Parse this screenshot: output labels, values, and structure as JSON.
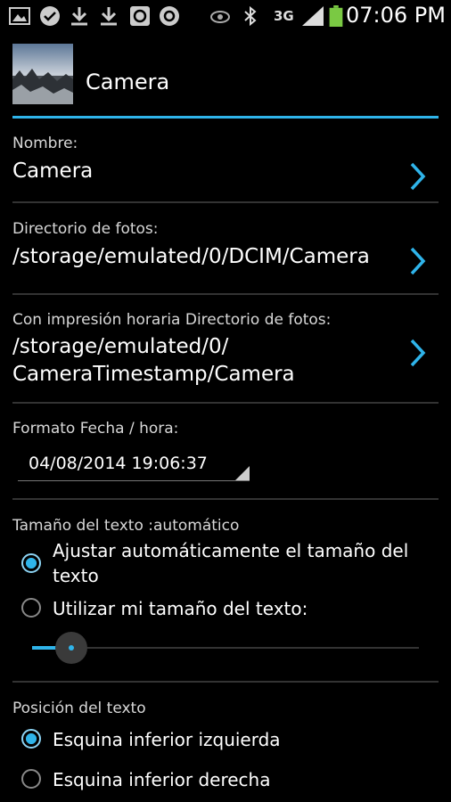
{
  "status_bar": {
    "time": "07:06 PM",
    "network": "3G",
    "icons": [
      "gallery-icon",
      "check-circle-icon",
      "download-icon",
      "download-icon",
      "app-icon",
      "sync-icon",
      "eye-icon",
      "bluetooth-icon",
      "signal-icon",
      "battery-icon"
    ]
  },
  "header": {
    "title": "Camera"
  },
  "prefs": {
    "nombre": {
      "label": "Nombre:",
      "value": "Camera"
    },
    "directorio": {
      "label": "Directorio de fotos:",
      "value": "/storage/emulated/0/DCIM/Camera"
    },
    "timestamp_dir": {
      "label": "Con impresión horaria Directorio de fotos:",
      "value_line1": "/storage/emulated/0/",
      "value_line2": "CameraTimestamp/Camera"
    },
    "formato": {
      "label": "Formato Fecha / hora:",
      "value": "04/08/2014 19:06:37"
    }
  },
  "text_size": {
    "label": "Tamaño del texto :automático",
    "option_auto_line1": "Ajustar automáticamente el tamaño del",
    "option_auto_line2": "texto",
    "option_custom": "Utilizar mi tamaño del texto:",
    "selected": "auto",
    "slider_level": 0.1
  },
  "text_position": {
    "label": "Posición del texto",
    "option_left": "Esquina inferior izquierda",
    "option_right": "Esquina inferior derecha",
    "selected": "left"
  },
  "colors": {
    "accent": "#2fb4ea",
    "background": "#000000"
  }
}
